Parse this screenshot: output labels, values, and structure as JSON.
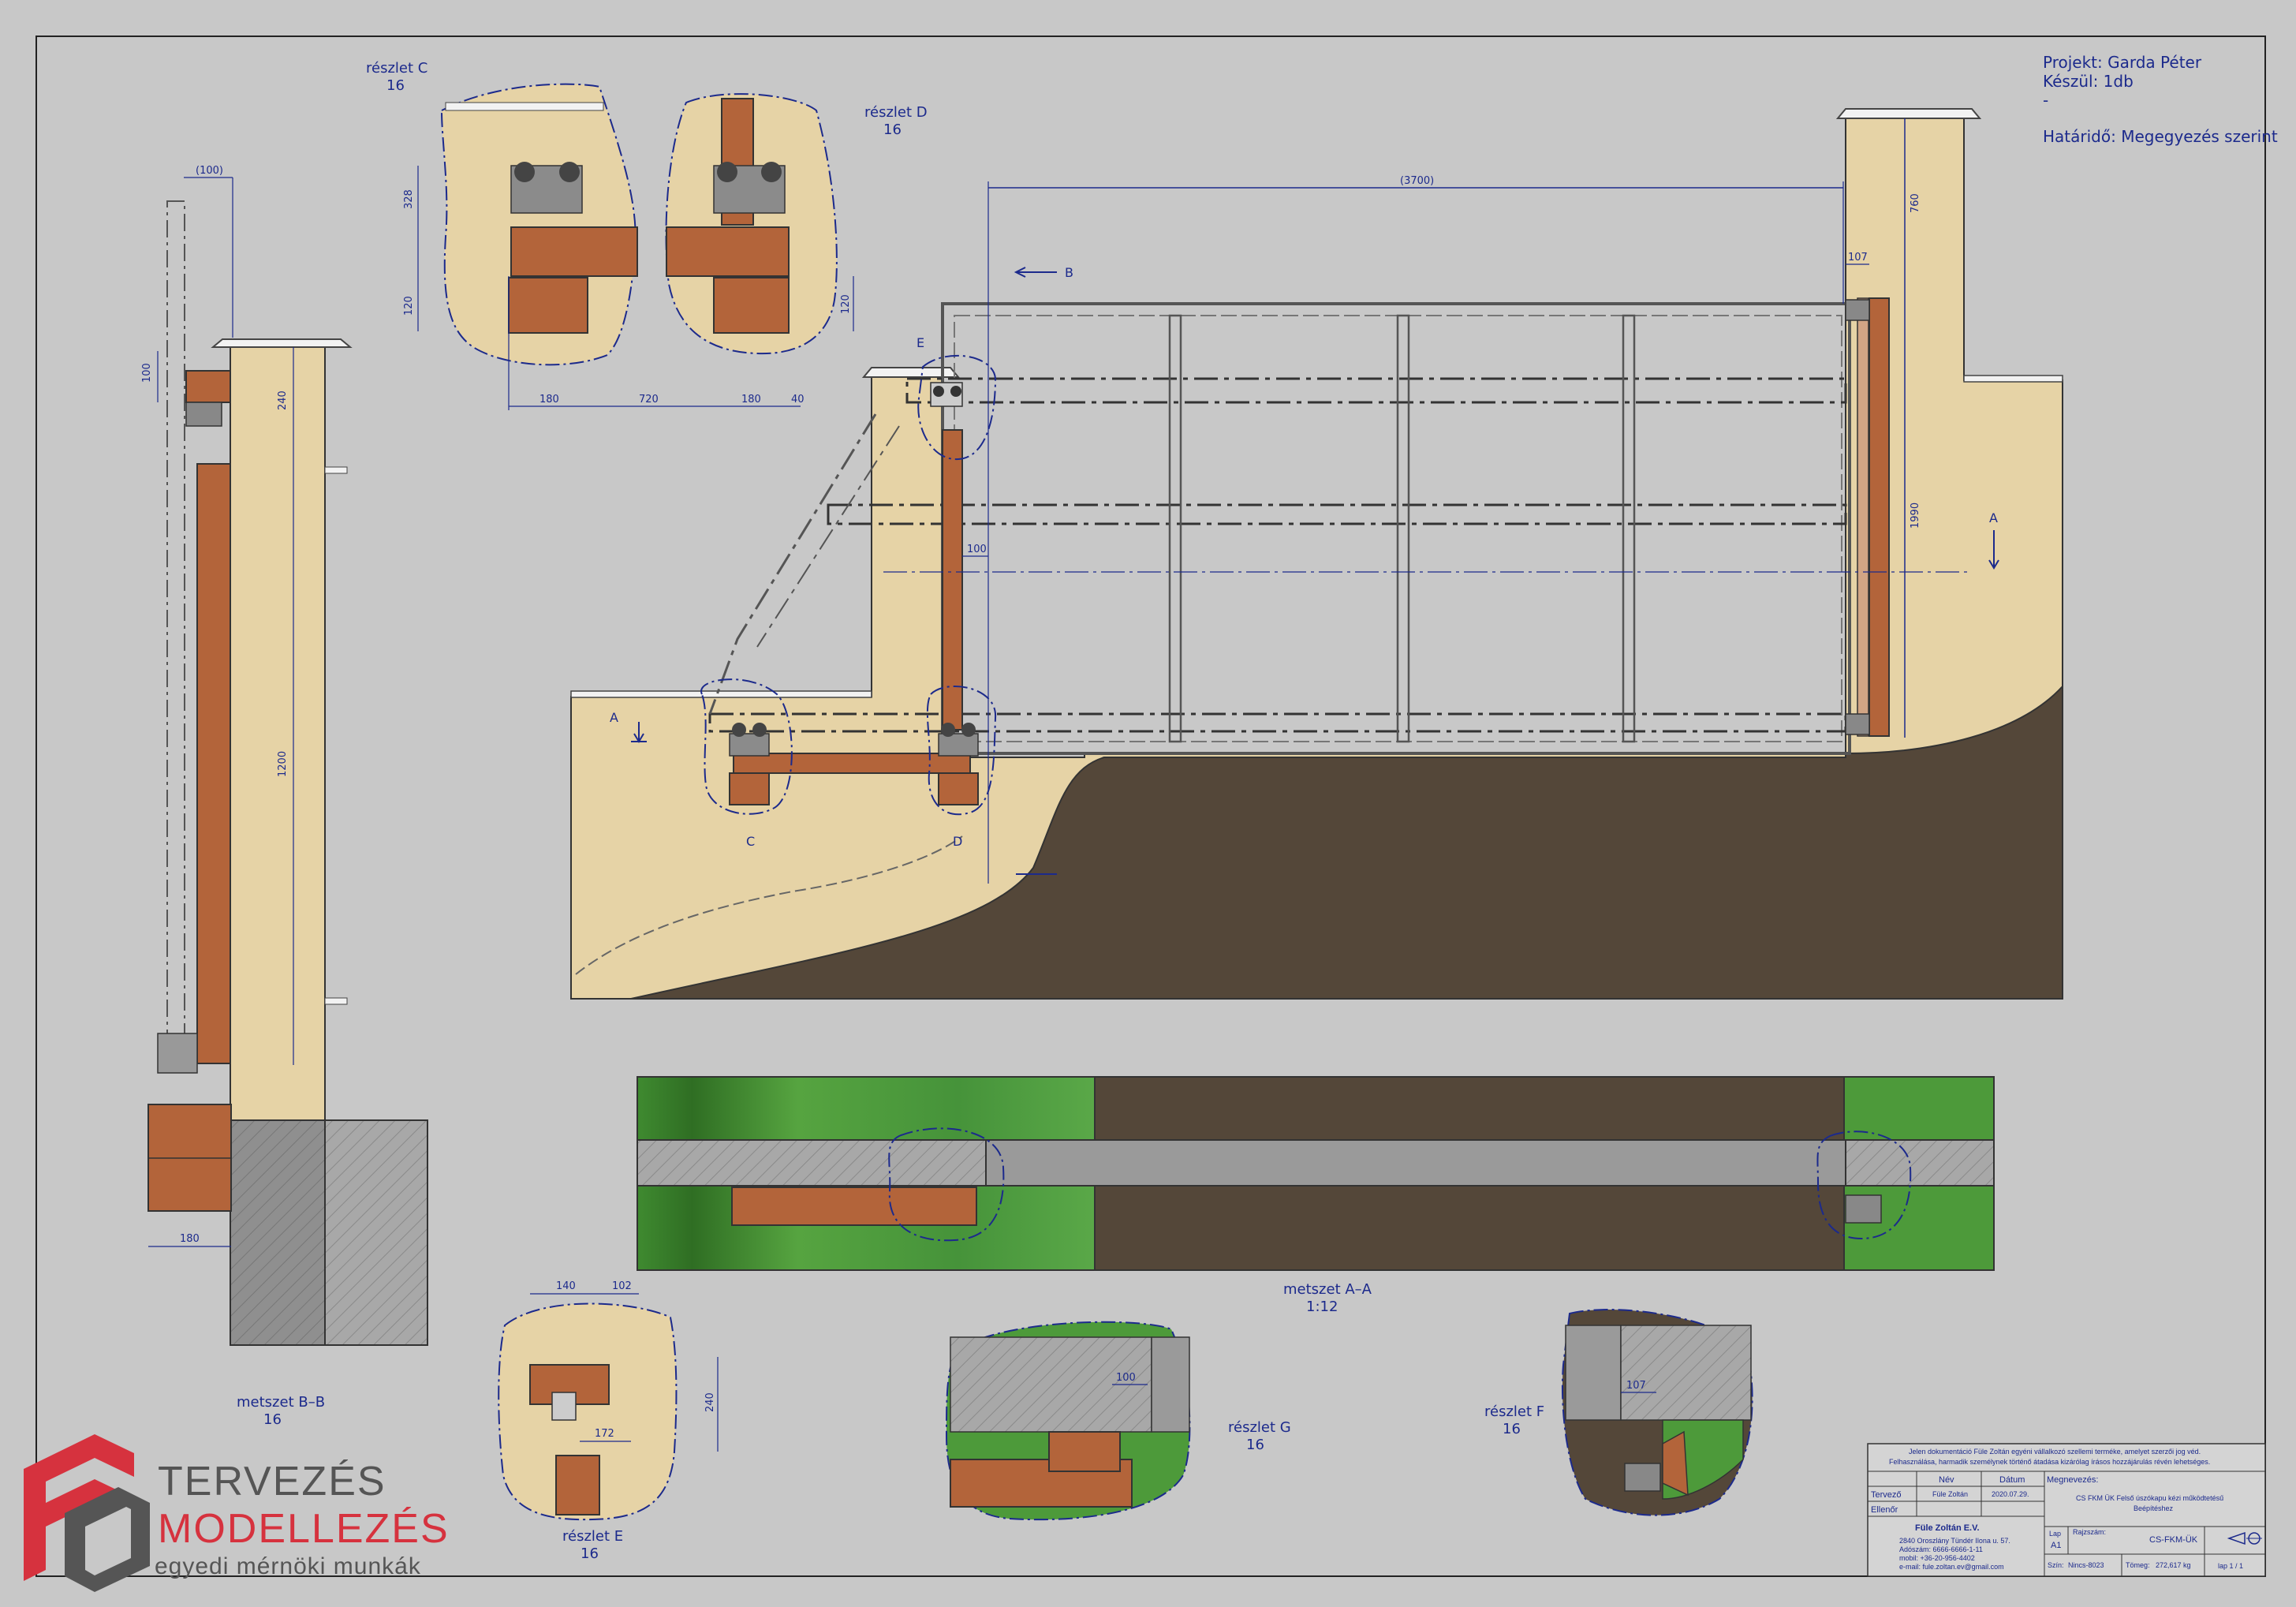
{
  "project": {
    "line1": "Projekt: Garda Péter",
    "line2": "Készül: 1db",
    "line3": "-",
    "line4": "Határidő: Megegyezés szerint"
  },
  "labels": {
    "detail_c": "részlet C",
    "detail_c_scale": "16",
    "detail_d": "részlet D",
    "detail_d_scale": "16",
    "detail_e": "részlet E",
    "detail_e_scale": "16",
    "detail_f": "részlet F",
    "detail_f_scale": "16",
    "detail_g": "részlet G",
    "detail_g_scale": "16",
    "section_bb": "metszet B–B",
    "section_bb_scale": "16",
    "section_aa": "metszet A–A",
    "section_aa_scale": "1:12",
    "mark_a": "A",
    "mark_b": "B",
    "mark_c": "C",
    "mark_d": "D",
    "mark_e": "E"
  },
  "dims": {
    "w3700": "(3700)",
    "w100top": "(100)",
    "h760": "760",
    "h1990": "1990",
    "w107": "107",
    "w100": "100",
    "h1200": "1200",
    "h240": "240",
    "w180": "180",
    "h100": "100",
    "c_w180a": "180",
    "c_w720": "720",
    "c_w180b": "180",
    "c_w40": "40",
    "c_h328": "328",
    "c_h120a": "120",
    "c_h120b": "120",
    "e_w140": "140",
    "e_w102": "102",
    "e_w172": "172",
    "e_h240": "240",
    "g_w100": "100",
    "f_w107": "107"
  },
  "title_block": {
    "legal": "Jelen dokumentáció Füle Zoltán egyéni vállalkozó szellemi terméke, amelyet szerzői jog véd.",
    "legal2": "Felhasználása, harmadik személynek történő átadása kizárólag írásos hozzájárulás révén lehetséges.",
    "col_name": "Név",
    "col_date": "Dátum",
    "row_designer": "Tervező",
    "designer_name": "Füle Zoltán",
    "design_date": "2020.07.29.",
    "row_checker": "Ellenőr",
    "designation_label": "Megnevezés:",
    "designation_1": "CS FKM ÜK   Felső úszókapu kézi működtetésű",
    "designation_2": "Beépítéshez",
    "company": "Füle Zoltán E.V.",
    "addr1": "2840 Oroszlány Tündér Ilona u. 57.",
    "addr2": "Adószám: 6666-6666-1-11",
    "addr3": "mobil: +36-20-956-4402",
    "addr4": "e-mail: fule.zoltan.ev@gmail.com",
    "sheet_label": "Lap",
    "sheet_size": "A1",
    "drawing_no_label": "Rajzszám:",
    "drawing_no": "CS-FKM-ÜK",
    "color_label": "Szín:",
    "color_val": "Nincs-8023",
    "weight_label": "Tömeg:",
    "weight_val": "272,617 kg",
    "page": "lap 1 / 1"
  },
  "logo": {
    "line1": "TERVEZÉS",
    "line2": "MODELLEZÉS",
    "tagline": "egyedi mérnöki munkák"
  },
  "colors": {
    "background": "#c8c8c8",
    "line": "#1c2a8c",
    "pillar": "#e6d3a6",
    "steel": "#b3643a",
    "soil": "#544739",
    "grass": "#4d9a3a",
    "concrete": "#9a9a9a",
    "logo_red": "#d6323e",
    "logo_grey": "#555555"
  }
}
